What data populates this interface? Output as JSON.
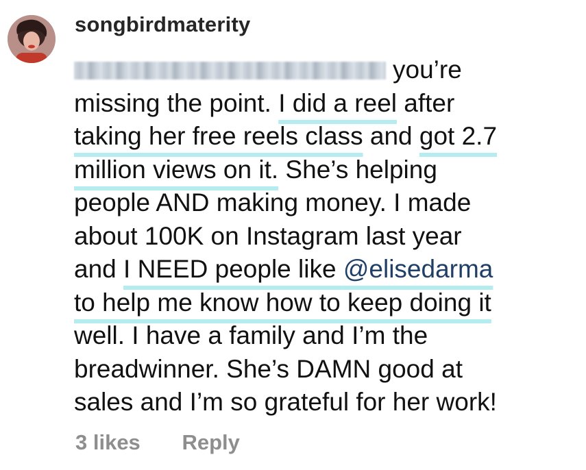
{
  "comment": {
    "author": "songbirdmaterity",
    "avatar_icon": "profile-photo-avatar",
    "text": {
      "l1": "you’re",
      "l2a": "missing the point. ",
      "l2b": "I did a reel",
      "l2c": " after",
      "l3a": "taking her free reels class",
      "l3b": " and ",
      "l3c": "got 2.7",
      "l4a": "million views on it.",
      "l4b": " She’s helping",
      "l5": "people AND making money. I made",
      "l6": "about 100K on Instagram last year",
      "l7a": "and ",
      "l7b": "I NEED people like ",
      "l7c": "@elisedarma",
      "l8": "to help me know how to keep doing it",
      "l9": "well. I have a family and I’m the",
      "l10": "breadwinner. She’s DAMN good at",
      "l11": "sales and I’m so grateful for her work!"
    },
    "likes_label": "3 likes",
    "reply_label": "Reply"
  },
  "colors": {
    "highlight_underline": "#b4ecef",
    "mention": "#1f3f67",
    "meta_text": "#8e8e8e"
  }
}
